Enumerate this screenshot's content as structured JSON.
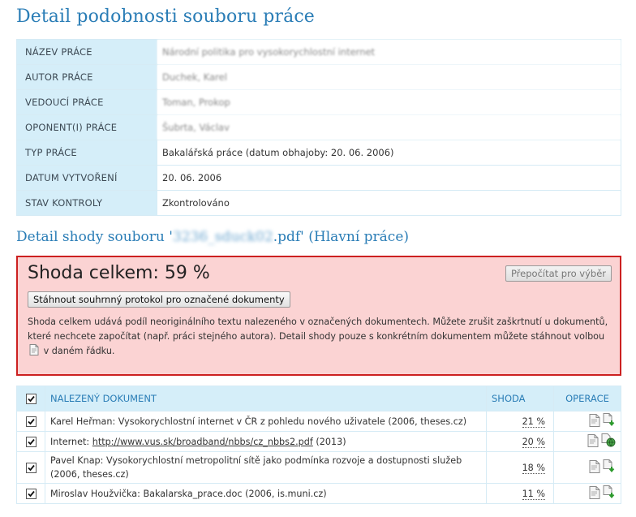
{
  "page_title": "Detail podobnosti souboru práce",
  "meta": [
    {
      "label": "NÁZEV PRÁCE",
      "value": "Národní politika pro vysokorychlostní internet",
      "blurred": true
    },
    {
      "label": "AUTOR PRÁCE",
      "value": "Duchek, Karel",
      "blurred": true
    },
    {
      "label": "VEDOUCÍ PRÁCE",
      "value": "Toman, Prokop",
      "blurred": true
    },
    {
      "label": "OPONENT(I) PRÁCE",
      "value": "Šubrta, Václav",
      "blurred": true
    },
    {
      "label": "TYP PRÁCE",
      "value": "Bakalářská práce (datum obhajoby: 20. 06. 2006)",
      "blurred": false
    },
    {
      "label": "DATUM VYTVOŘENÍ",
      "value": "20. 06. 2006",
      "blurred": false
    },
    {
      "label": "STAV KONTROLY",
      "value": "Zkontrolováno",
      "blurred": false
    }
  ],
  "section": {
    "prefix": "Detail shody souboru '",
    "file": "3236_sduck02",
    "suffix": ".pdf' (Hlavní práce)"
  },
  "match": {
    "total_label": "Shoda celkem: 59 %",
    "recalc_button": "Přepočítat pro výběr",
    "download_button": "Stáhnout souhrnný protokol pro označené dokumenty",
    "description_before_icon": "Shoda celkem udává podíl neoriginálního textu nalezeného v označených dokumentech. Můžete zrušit zaškrtnutí u dokumentů, které nechcete započítat (např. práci stejného autora). Detail shody pouze s konkrétním dokumentem můžete stáhnout volbou",
    "description_after_icon": "v daném řádku."
  },
  "docs_table": {
    "headers": {
      "document": "NALEZENÝ DOKUMENT",
      "match": "SHODA",
      "operations": "OPERACE"
    },
    "rows": [
      {
        "checked": true,
        "text": "Karel Heřman: Vysokorychlostní internet v ČR z pohledu nového uživatele (2006, theses.cz)",
        "link": "",
        "after": "",
        "match": "21 %",
        "second_icon": "download-icon"
      },
      {
        "checked": true,
        "text": "Internet: ",
        "link": "http://www.vus.sk/broadband/nbbs/cz_nbbs2.pdf",
        "after": " (2013)",
        "match": "20 %",
        "second_icon": "web-link-icon"
      },
      {
        "checked": true,
        "text": "Pavel Knap: Vysokorychlostní metropolitní sítě jako podmínka rozvoje a dostupnosti služeb (2006, theses.cz)",
        "link": "",
        "after": "",
        "match": "18 %",
        "second_icon": "download-icon"
      },
      {
        "checked": true,
        "text": "Miroslav Houžvička: Bakalarska_prace.doc (2006, is.muni.cz)",
        "link": "",
        "after": "",
        "match": "11 %",
        "second_icon": "download-icon"
      }
    ]
  },
  "colors": {
    "accent": "#2a7db6",
    "header_bg": "#d5eef9",
    "alert_bg": "#fbd3d3",
    "alert_border": "#cc2020"
  }
}
